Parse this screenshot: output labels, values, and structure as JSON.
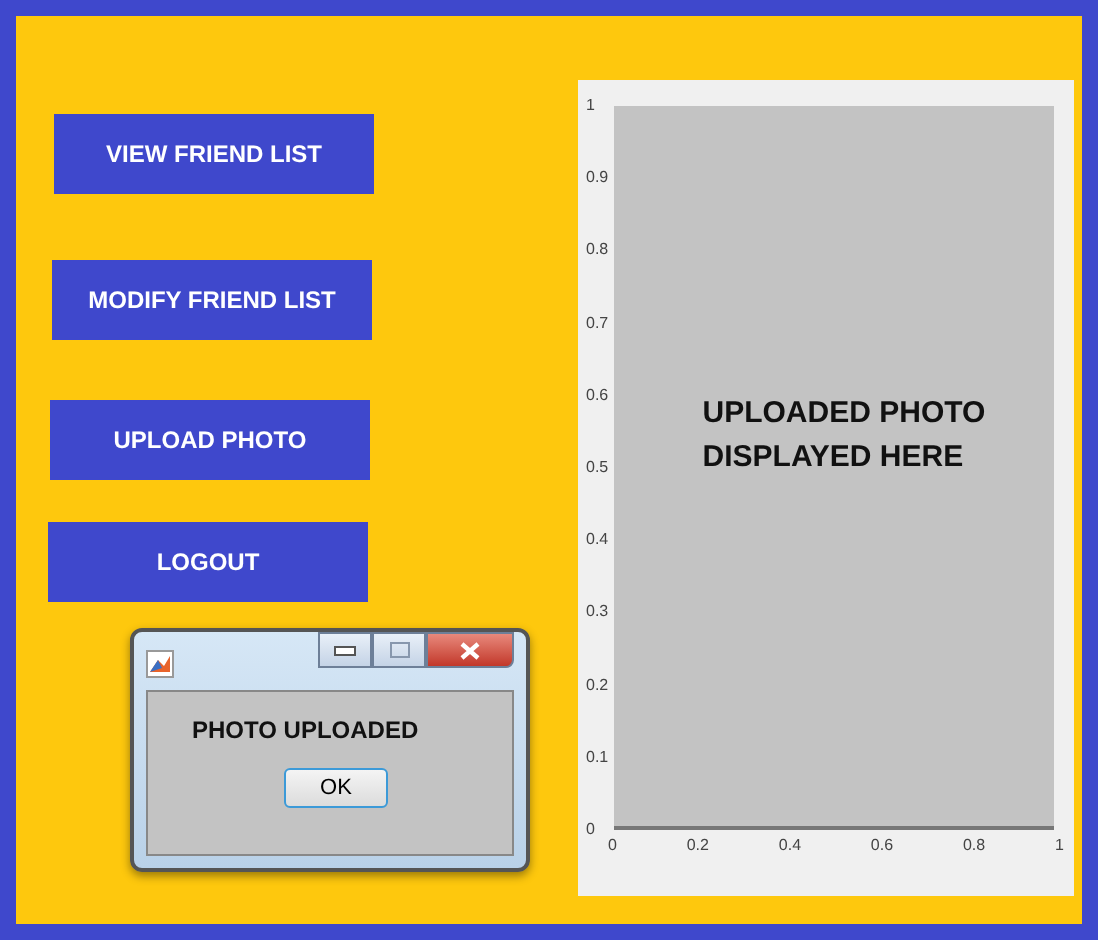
{
  "buttons": [
    {
      "label": "VIEW FRIEND LIST"
    },
    {
      "label": "MODIFY FRIEND LIST"
    },
    {
      "label": "UPLOAD PHOTO"
    },
    {
      "label": "LOGOUT"
    }
  ],
  "dialog": {
    "message": "PHOTO UPLOADED",
    "button": "OK"
  },
  "axes": {
    "placeholder_lines": [
      "UPLOADED PHOTO",
      "DISPLAYED HERE"
    ],
    "yticks": [
      "1",
      "0.9",
      "0.8",
      "0.7",
      "0.6",
      "0.5",
      "0.4",
      "0.3",
      "0.2",
      "0.1",
      "0"
    ],
    "xticks": [
      "0",
      "0.2",
      "0.4",
      "0.6",
      "0.8",
      "1"
    ]
  }
}
